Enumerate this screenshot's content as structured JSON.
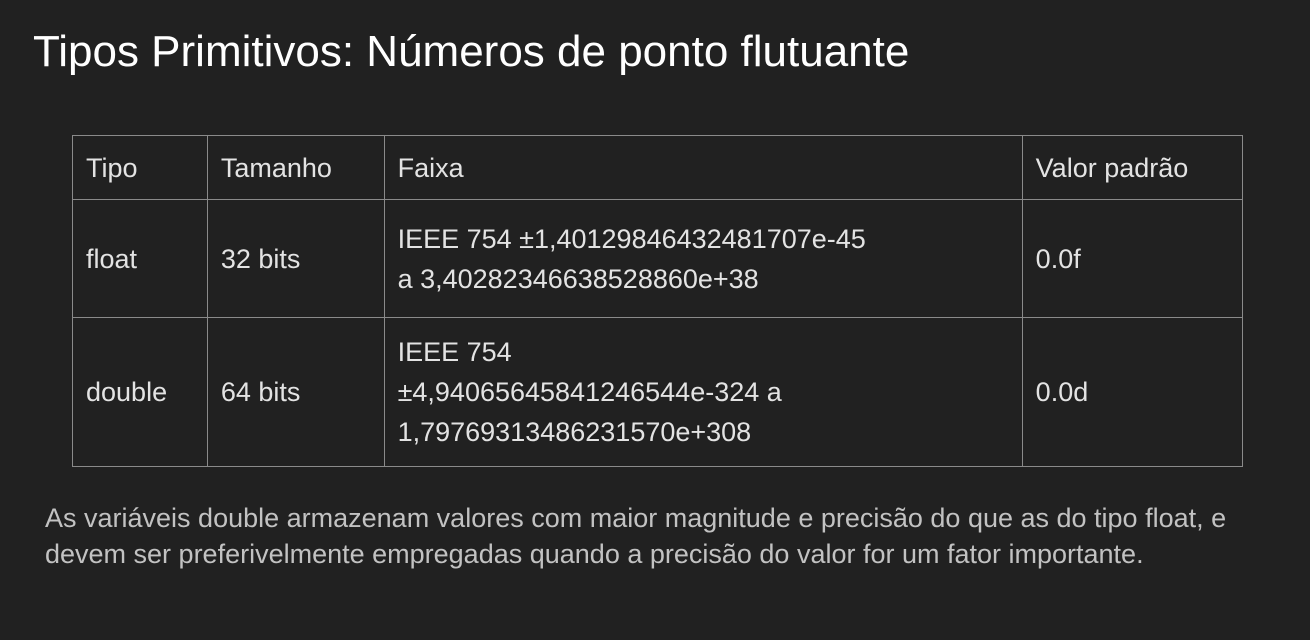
{
  "slide": {
    "title": "Tipos Primitivos: Números de ponto flutuante"
  },
  "table": {
    "headers": {
      "tipo": "Tipo",
      "tamanho": "Tamanho",
      "faixa": "Faixa",
      "valor_padrao": "Valor padrão"
    },
    "rows": [
      {
        "tipo": "float",
        "tamanho": "32 bits",
        "faixa_lines": [
          "IEEE 754 ±1,40129846432481707e-45",
          "a 3,40282346638528860e+38"
        ],
        "valor_padrao": "0.0f"
      },
      {
        "tipo": "double",
        "tamanho": "64 bits",
        "faixa_lines": [
          "IEEE 754",
          "±4,94065645841246544e-324 a",
          "1,79769313486231570e+308"
        ],
        "valor_padrao": "0.0d"
      }
    ]
  },
  "footnote": "As variáveis double armazenam valores com maior magnitude e precisão do que as do tipo float, e devem ser preferivelmente empregadas quando a precisão do valor for um fator importante.",
  "colors": {
    "background": "#212121",
    "title": "#ffffff",
    "table_text": "#e3e3e3",
    "table_border": "#8a8a8a",
    "footnote": "#c2c2c2"
  }
}
